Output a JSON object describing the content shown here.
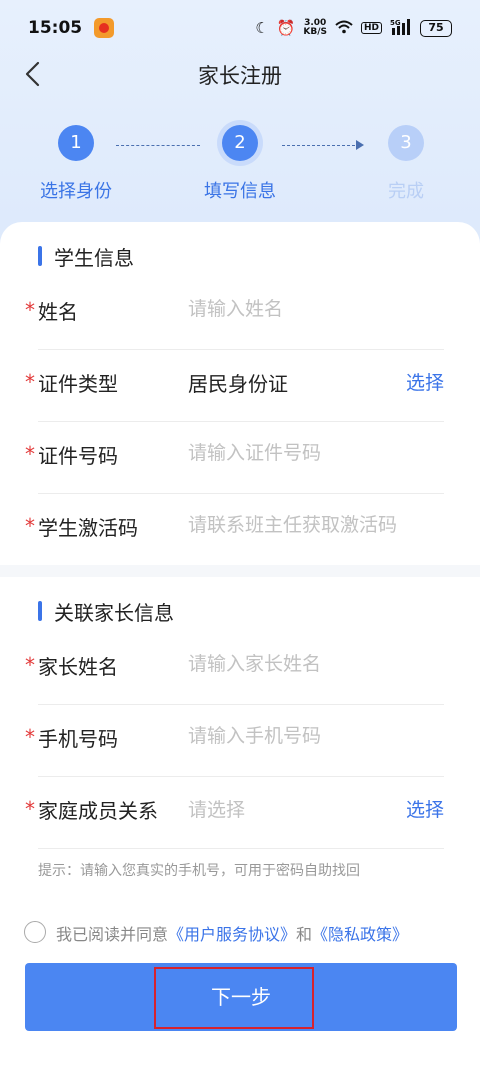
{
  "status_bar": {
    "time": "15:05",
    "net_speed_value": "3.00",
    "net_speed_unit": "KB/S",
    "hd": "HD",
    "network": "5G",
    "battery": "75"
  },
  "header": {
    "title": "家长注册"
  },
  "steps": [
    {
      "number": "1",
      "label": "选择身份",
      "state": "done"
    },
    {
      "number": "2",
      "label": "填写信息",
      "state": "active"
    },
    {
      "number": "3",
      "label": "完成",
      "state": "pending"
    }
  ],
  "student_section": {
    "title": "学生信息",
    "name": {
      "required": "*",
      "label": "姓名",
      "placeholder": "请输入姓名"
    },
    "id_type": {
      "required": "*",
      "label": "证件类型",
      "value": "居民身份证",
      "action": "选择"
    },
    "id_number": {
      "required": "*",
      "label": "证件号码",
      "placeholder": "请输入证件号码"
    },
    "activation_code": {
      "required": "*",
      "label": "学生激活码",
      "placeholder": "请联系班主任获取激活码"
    }
  },
  "parent_section": {
    "title": "关联家长信息",
    "parent_name": {
      "required": "*",
      "label": "家长姓名",
      "placeholder": "请输入家长姓名"
    },
    "phone": {
      "required": "*",
      "label": "手机号码",
      "placeholder": "请输入手机号码"
    },
    "relation": {
      "required": "*",
      "label": "家庭成员关系",
      "placeholder": "请选择",
      "action": "选择"
    }
  },
  "tip": "提示：请输入您真实的手机号，可用于密码自助找回",
  "agreement": {
    "prefix": "我已阅读并同意",
    "user_agreement": "《用户服务协议》",
    "and": "和",
    "privacy_policy": "《隐私政策》"
  },
  "next_button": "下一步",
  "colors": {
    "accent": "#4b86f2",
    "required": "#e23a3a",
    "highlight": "#d6232e"
  }
}
